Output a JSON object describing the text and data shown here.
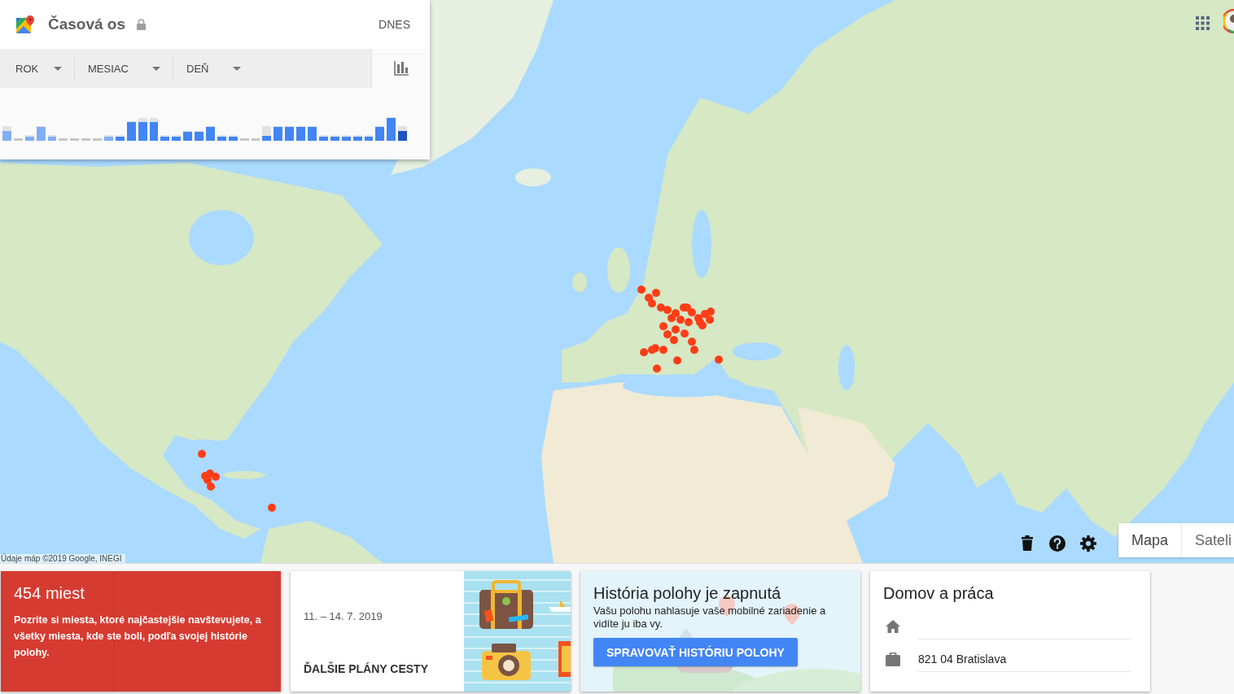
{
  "timeline_panel": {
    "title": "Časová os",
    "today_button": "DNES",
    "filters": [
      {
        "label": "ROK"
      },
      {
        "label": "MESIAC"
      },
      {
        "label": "DEŇ"
      }
    ],
    "chart_toggle": {
      "selected": true
    }
  },
  "map": {
    "attribution": "Údaje máp ©2019 Google, INEGI",
    "map_types": [
      {
        "label": "Mapa",
        "selected": true
      },
      {
        "label": "Sateli",
        "selected": false
      }
    ]
  },
  "cards": [
    {
      "kind": "places",
      "title": "454 miest",
      "text": "Pozrite si miesta, ktoré najčastejšie navštevujete, a všetky miesta, kde ste boli, podľa svojej histórie polohy."
    },
    {
      "kind": "trips",
      "dates": "11. – 14. 7. 2019",
      "link": "ĎALŠIE PLÁNY CESTY"
    },
    {
      "kind": "history",
      "title": "História polohy je zapnutá",
      "text": "Vašu polohu nahlasuje vaše mobilné zariadenie a vidíte ju iba vy.",
      "button": "SPRAVOVAŤ HISTÓRIU POLOHY"
    },
    {
      "kind": "home_work",
      "title": "Domov a práca",
      "entries": [
        {
          "kind": "home"
        },
        {
          "kind": "work",
          "value": "821 04 Bratislava"
        }
      ]
    }
  ]
}
